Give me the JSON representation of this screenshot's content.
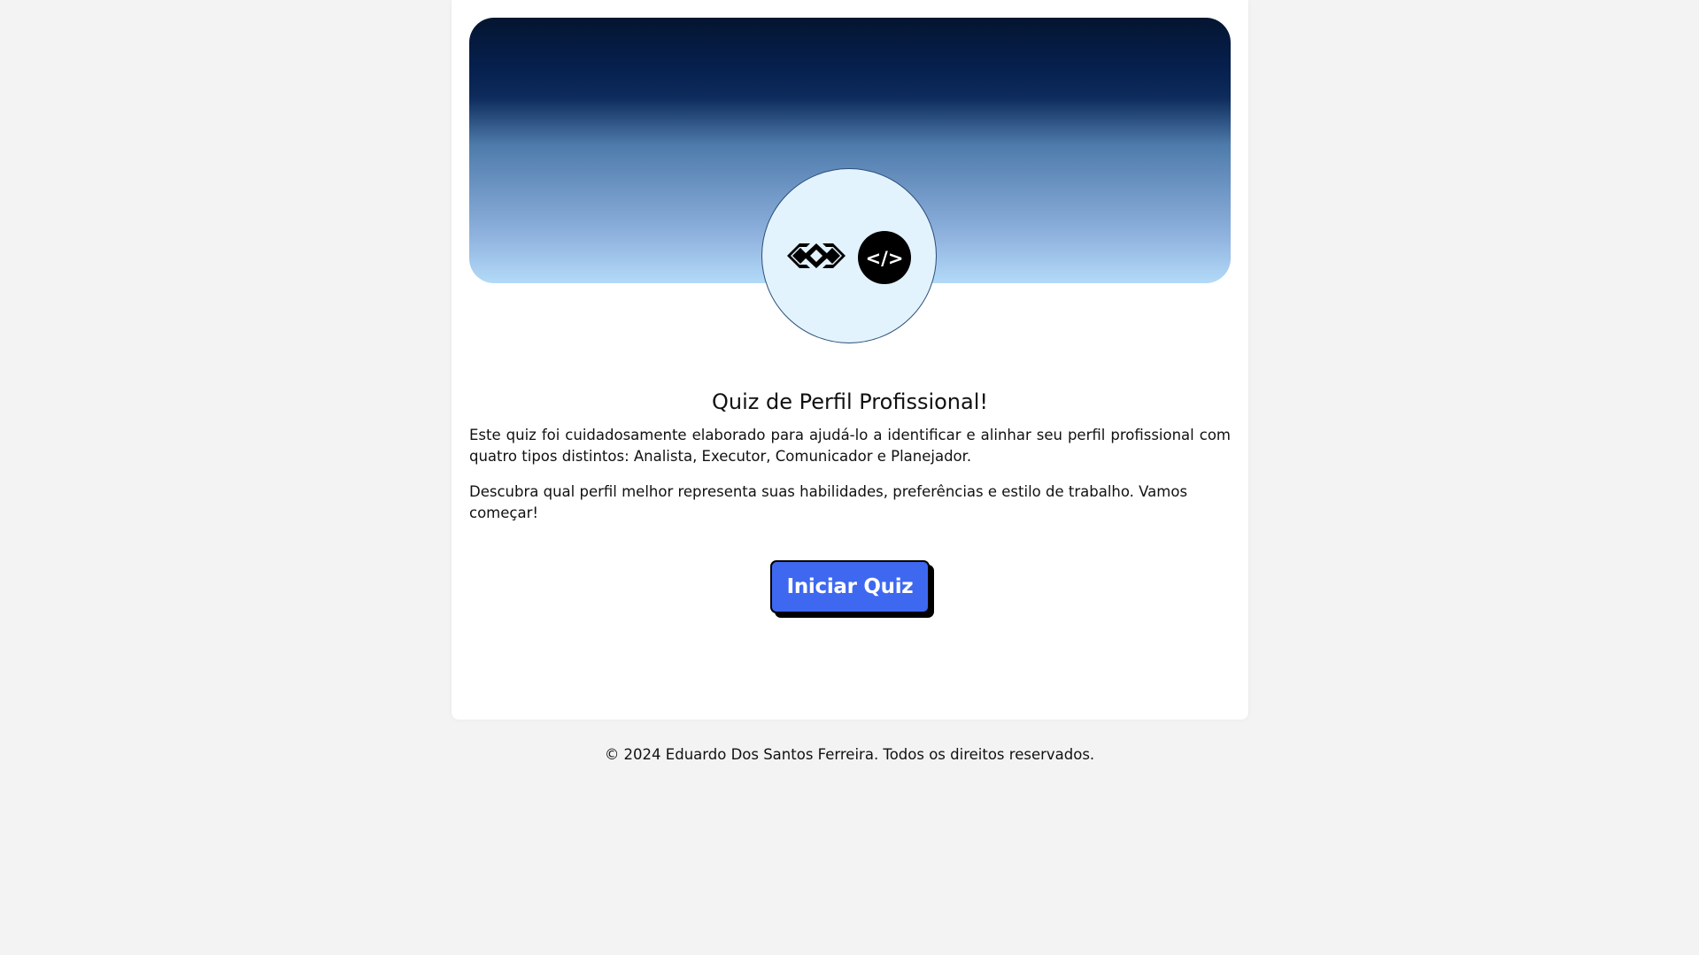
{
  "header": {
    "logos": [
      {
        "icon": "diamonds-logo-icon"
      },
      {
        "icon": "code-brackets-icon",
        "text": "</>"
      }
    ]
  },
  "main": {
    "title": "Quiz de Perfil Profissional!",
    "paragraph1": "Este quiz foi cuidadosamente elaborado para ajudá-lo a identificar e alinhar seu perfil profissional com quatro tipos distintos: Analista, Executor, Comunicador e Planejador.",
    "paragraph2": "Descubra qual perfil melhor representa suas habilidades, preferências e estilo de trabalho. Vamos começar!",
    "start_button_label": "Iniciar Quiz"
  },
  "footer": {
    "text": "© 2024 Eduardo Dos Santos Ferreira. Todos os direitos reservados."
  },
  "colors": {
    "page_background": "#f3f3f3",
    "card_background": "#ffffff",
    "banner_top": "#041530",
    "banner_bottom": "#b3daf8",
    "avatar_background": "#e2f3fd",
    "button_background": "#3e68f0",
    "button_text": "#ffffff"
  }
}
